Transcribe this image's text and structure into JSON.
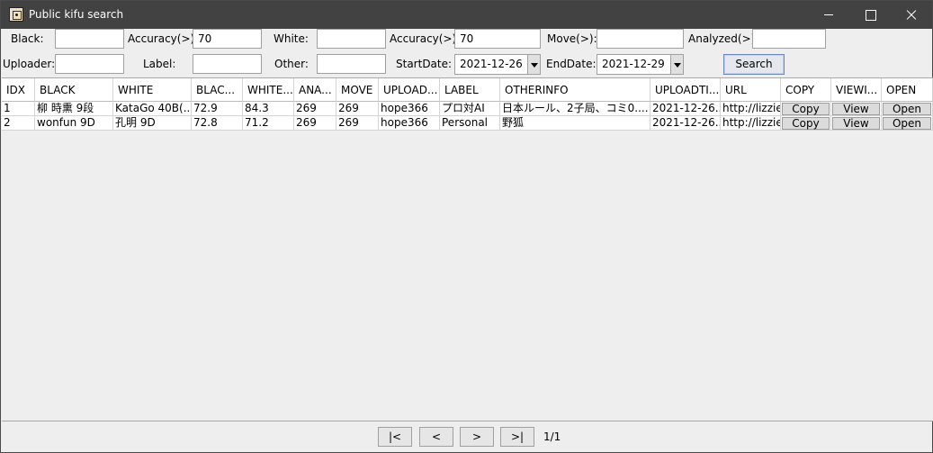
{
  "window": {
    "title": "Public kifu search"
  },
  "filters": {
    "black_label": "Black:",
    "black_value": "",
    "black_accuracy_label": "Accuracy(>):",
    "black_accuracy_value": "70",
    "white_label": "White:",
    "white_value": "",
    "white_accuracy_label": "Accuracy(>):",
    "white_accuracy_value": "70",
    "move_label": "Move(>):",
    "move_value": "",
    "analyzed_label": "Analyzed(>):",
    "analyzed_value": "",
    "uploader_label": "Uploader:",
    "uploader_value": "",
    "label_label": "Label:",
    "label_value": "",
    "other_label": "Other:",
    "other_value": "",
    "start_date_label": "StartDate:",
    "start_date_value": "2021-12-26",
    "end_date_label": "EndDate:",
    "end_date_value": "2021-12-29",
    "search_label": "Search"
  },
  "table": {
    "headers": [
      "IDX",
      "BLACK",
      "WHITE",
      "BLAC...",
      "WHITE...",
      "ANA...",
      "MOVE",
      "UPLOAD...",
      "LABEL",
      "OTHERINFO",
      "UPLOADTI...",
      "URL",
      "COPY",
      "VIEWI...",
      "OPEN"
    ],
    "rows": [
      {
        "idx": "1",
        "black": "柳 時熏 9段",
        "white": "KataGo 40B(...",
        "black_acc": "72.9",
        "white_acc": "84.3",
        "analyzed": "269",
        "move": "269",
        "uploader": "hope366",
        "label": "プロ対AI",
        "otherinfo": "日本ルール、2子局、コミ0....",
        "uploadtime": "2021-12-26...",
        "url": "http://lizzie...",
        "copy": "Copy",
        "view": "View",
        "open": "Open"
      },
      {
        "idx": "2",
        "black": "wonfun 9D",
        "white": "孔明 9D",
        "black_acc": "72.8",
        "white_acc": "71.2",
        "analyzed": "269",
        "move": "269",
        "uploader": "hope366",
        "label": "Personal",
        "otherinfo": "野狐",
        "uploadtime": "2021-12-26...",
        "url": "http://lizzie...",
        "copy": "Copy",
        "view": "View",
        "open": "Open"
      }
    ]
  },
  "pagination": {
    "first": "|<",
    "prev": "<",
    "next": ">",
    "last": ">|",
    "page_info": "1/1"
  }
}
